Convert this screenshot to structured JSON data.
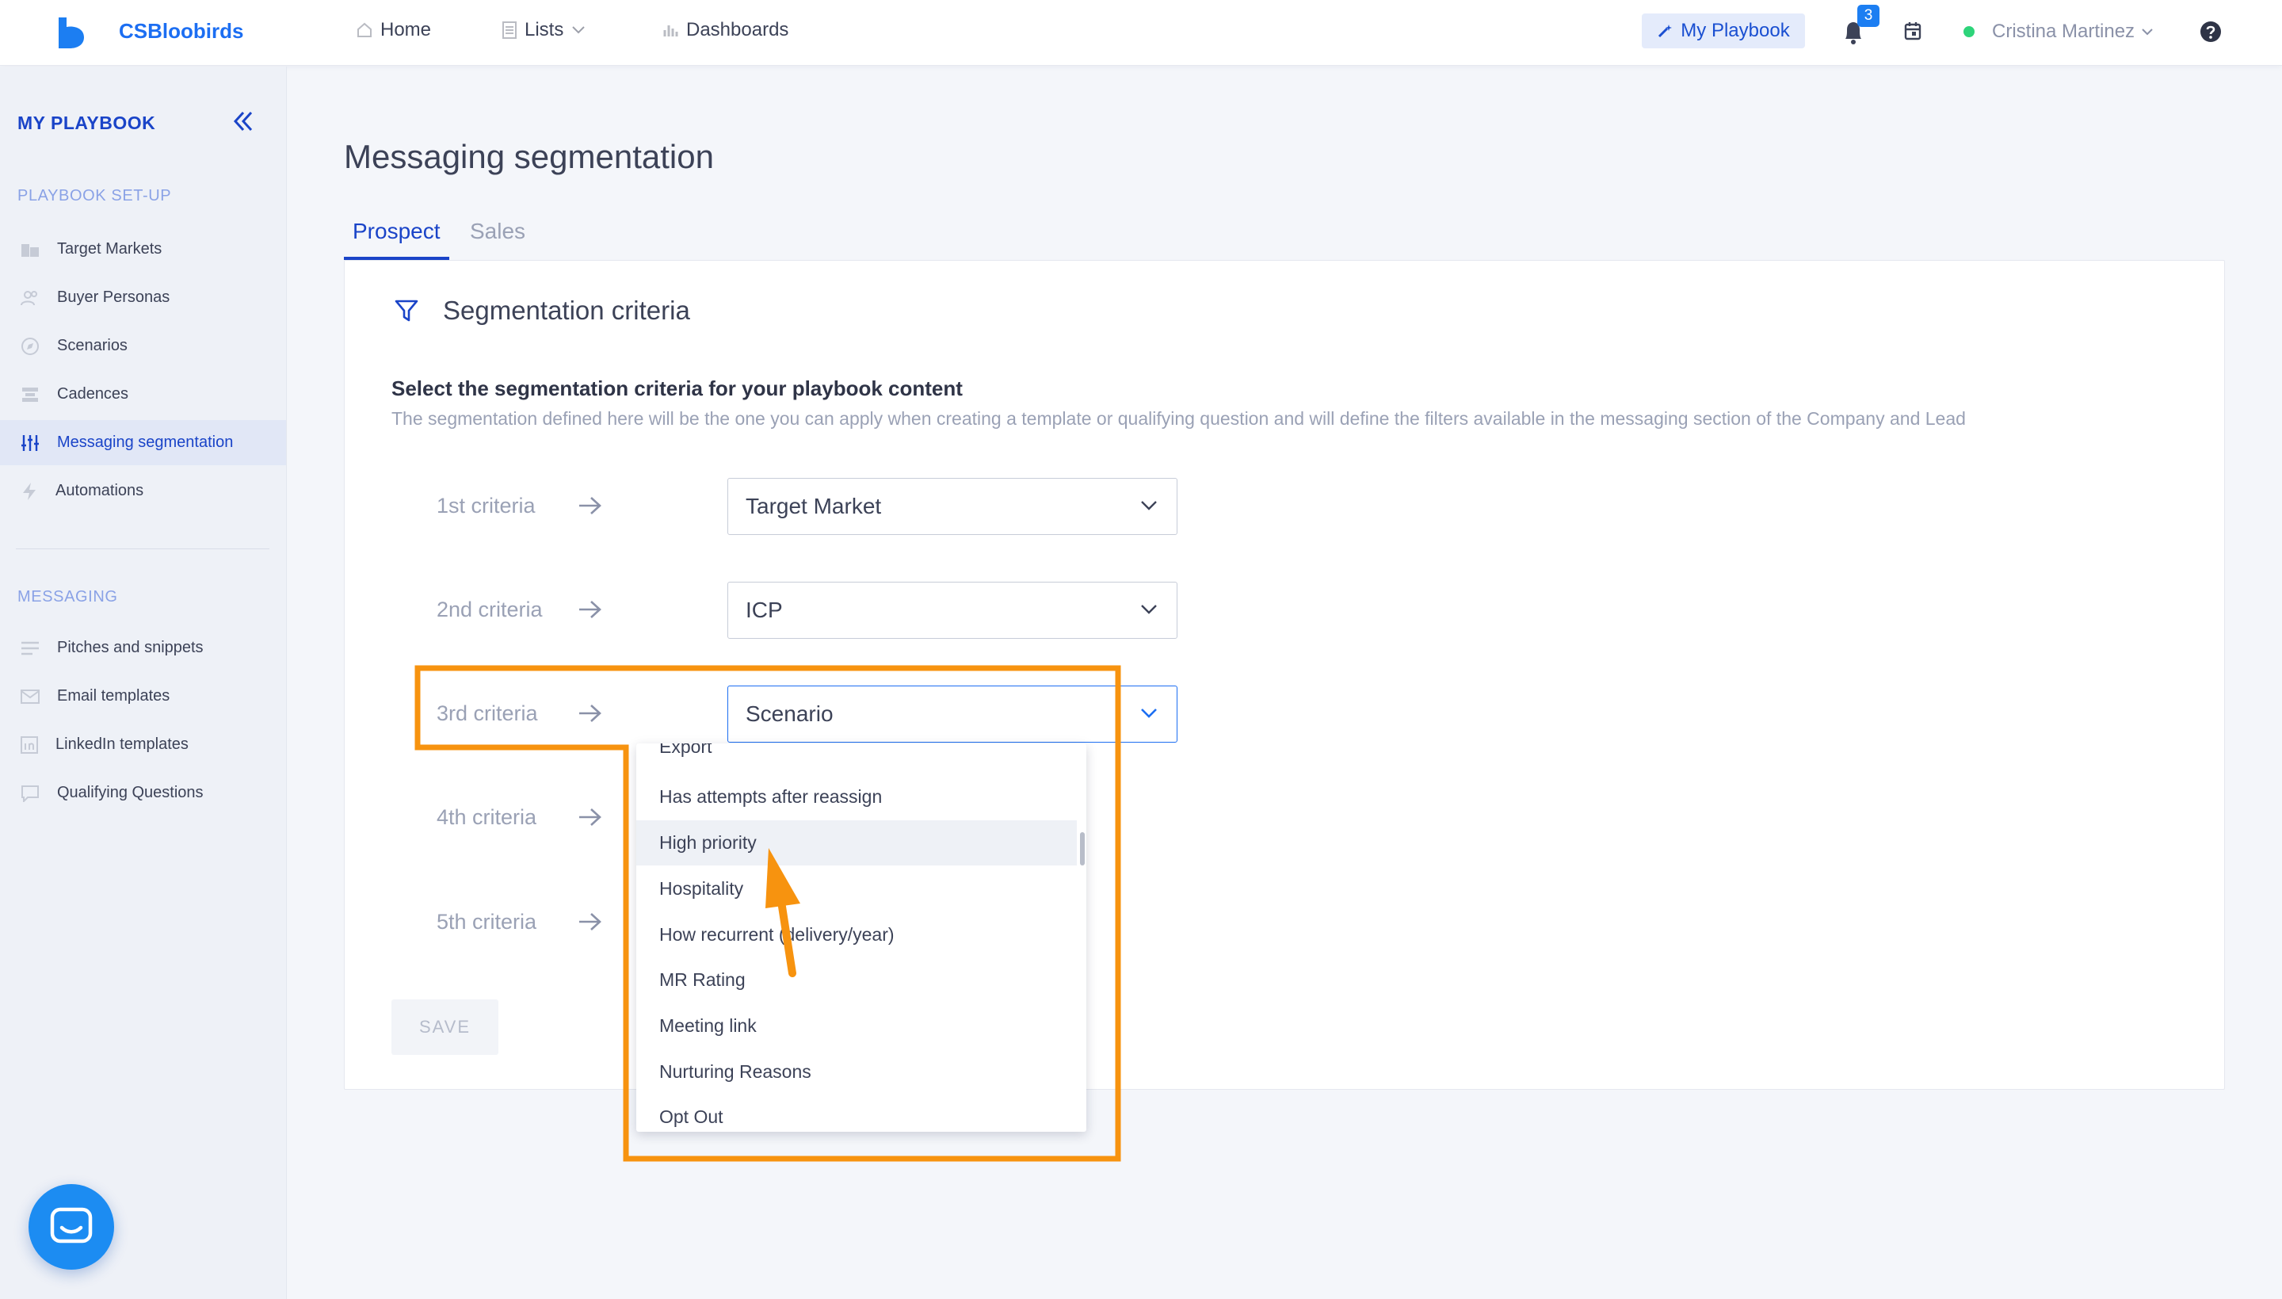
{
  "topbar": {
    "brand": "CSBloobirds",
    "nav": [
      {
        "label": "Home",
        "icon": "home-icon"
      },
      {
        "label": "Lists",
        "icon": "list-icon"
      },
      {
        "label": "Dashboards",
        "icon": "chart-icon"
      }
    ],
    "my_playbook_label": "My Playbook",
    "notifications_count": "3",
    "user_name": "Cristina Martinez"
  },
  "sidebar": {
    "title": "MY PLAYBOOK",
    "sections": [
      {
        "label": "PLAYBOOK SET-UP",
        "items": [
          {
            "label": "Target Markets",
            "icon": "building-icon"
          },
          {
            "label": "Buyer Personas",
            "icon": "people-icon"
          },
          {
            "label": "Scenarios",
            "icon": "compass-icon"
          },
          {
            "label": "Cadences",
            "icon": "cadence-icon"
          },
          {
            "label": "Messaging segmentation",
            "icon": "sliders-icon",
            "active": true
          },
          {
            "label": "Automations",
            "icon": "bolt-icon"
          }
        ]
      },
      {
        "label": "MESSAGING",
        "items": [
          {
            "label": "Pitches and snippets",
            "icon": "lines-icon"
          },
          {
            "label": "Email templates",
            "icon": "mail-icon"
          },
          {
            "label": "LinkedIn templates",
            "icon": "linkedin-icon"
          },
          {
            "label": "Qualifying Questions",
            "icon": "chat-icon"
          }
        ]
      }
    ]
  },
  "main": {
    "title": "Messaging segmentation",
    "tabs": [
      {
        "label": "Prospect",
        "active": true
      },
      {
        "label": "Sales",
        "active": false
      }
    ],
    "card": {
      "heading": "Segmentation criteria",
      "subtitle": "Select the segmentation criteria for your playbook content",
      "description": "The segmentation defined here will be the one you can apply when creating a template or qualifying question and will define the filters available in the messaging section of the Company and Lead",
      "criteria": [
        {
          "label": "1st criteria",
          "value": "Target Market"
        },
        {
          "label": "2nd criteria",
          "value": "ICP"
        },
        {
          "label": "3rd criteria",
          "value": "Scenario"
        },
        {
          "label": "4th criteria",
          "value": ""
        },
        {
          "label": "5th criteria",
          "value": ""
        }
      ],
      "save_label": "SAVE"
    },
    "dropdown": {
      "items": [
        "Export",
        "Has attempts after reassign",
        "High priority",
        "Hospitality",
        "How recurrent (delivery/year)",
        "MR Rating",
        "Meeting link",
        "Nurturing Reasons",
        "Opt Out"
      ],
      "hovered": "High priority"
    }
  },
  "colors": {
    "accent": "#1a44c8",
    "brand": "#1c6ef2",
    "annotation": "#f7930f",
    "online": "#2ed47a"
  }
}
